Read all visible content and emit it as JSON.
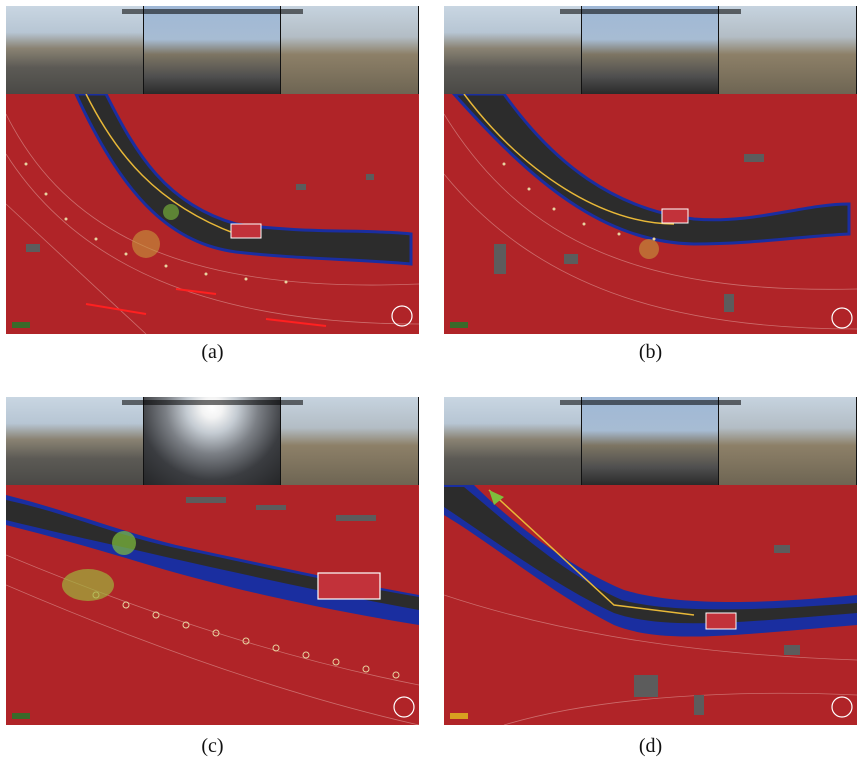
{
  "figure": {
    "panels": [
      {
        "id": "a",
        "caption": "(a)"
      },
      {
        "id": "b",
        "caption": "(b)"
      },
      {
        "id": "c",
        "caption": "(c)"
      },
      {
        "id": "d",
        "caption": "(d)"
      }
    ]
  },
  "colors": {
    "costmap_red": "#b02428",
    "road_dark": "#2c2c2c",
    "obstacle_blue": "#1a2ea0",
    "grid_line": "#d98c8a",
    "waypoint": "#e8d4a0",
    "vehicle": "#c2323a",
    "detection_green": "#7fbf3c",
    "path_yellow": "#e8b838"
  }
}
